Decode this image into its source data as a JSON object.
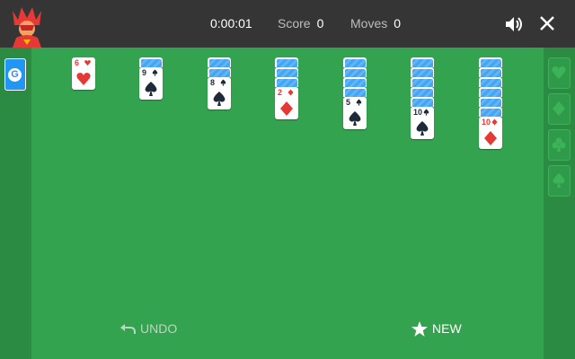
{
  "header": {
    "timer": "0:00:01",
    "score_label": "Score",
    "score_value": "0",
    "moves_label": "Moves",
    "moves_value": "0",
    "sound_icon": "speaker-icon",
    "close_icon": "close-icon"
  },
  "stock": {
    "logo": "G"
  },
  "foundations": [
    "heart",
    "diamond",
    "club",
    "spade"
  ],
  "tableau": [
    {
      "hidden": 0,
      "rank": "6",
      "suit": "heart"
    },
    {
      "hidden": 1,
      "rank": "9",
      "suit": "spade"
    },
    {
      "hidden": 2,
      "rank": "8",
      "suit": "spade"
    },
    {
      "hidden": 3,
      "rank": "2",
      "suit": "diamond"
    },
    {
      "hidden": 4,
      "rank": "5",
      "suit": "spade"
    },
    {
      "hidden": 5,
      "rank": "10",
      "suit": "spade"
    },
    {
      "hidden": 6,
      "rank": "10",
      "suit": "diamond"
    }
  ],
  "footer": {
    "undo_label": "UNDO",
    "new_label": "NEW"
  },
  "colors": {
    "felt": "#33a34f",
    "topbar": "#353535",
    "red_suit": "#e53935",
    "black_suit": "#1d2a3a"
  }
}
